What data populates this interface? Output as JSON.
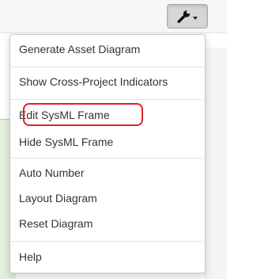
{
  "toolbar": {
    "wrench_icon": "wrench-icon",
    "caret_icon": "caret-down-icon"
  },
  "menu": {
    "groups": [
      [
        "Generate Asset Diagram"
      ],
      [
        "Show Cross-Project Indicators"
      ],
      [
        "Edit SysML Frame",
        "Hide SysML Frame"
      ],
      [
        "Auto Number",
        "Layout Diagram",
        "Reset Diagram"
      ],
      [
        "Help"
      ]
    ],
    "highlighted_item": "Edit SysML Frame"
  },
  "colors": {
    "highlight_ring": "#e0202a",
    "canvas_green": "#e4efdc"
  }
}
